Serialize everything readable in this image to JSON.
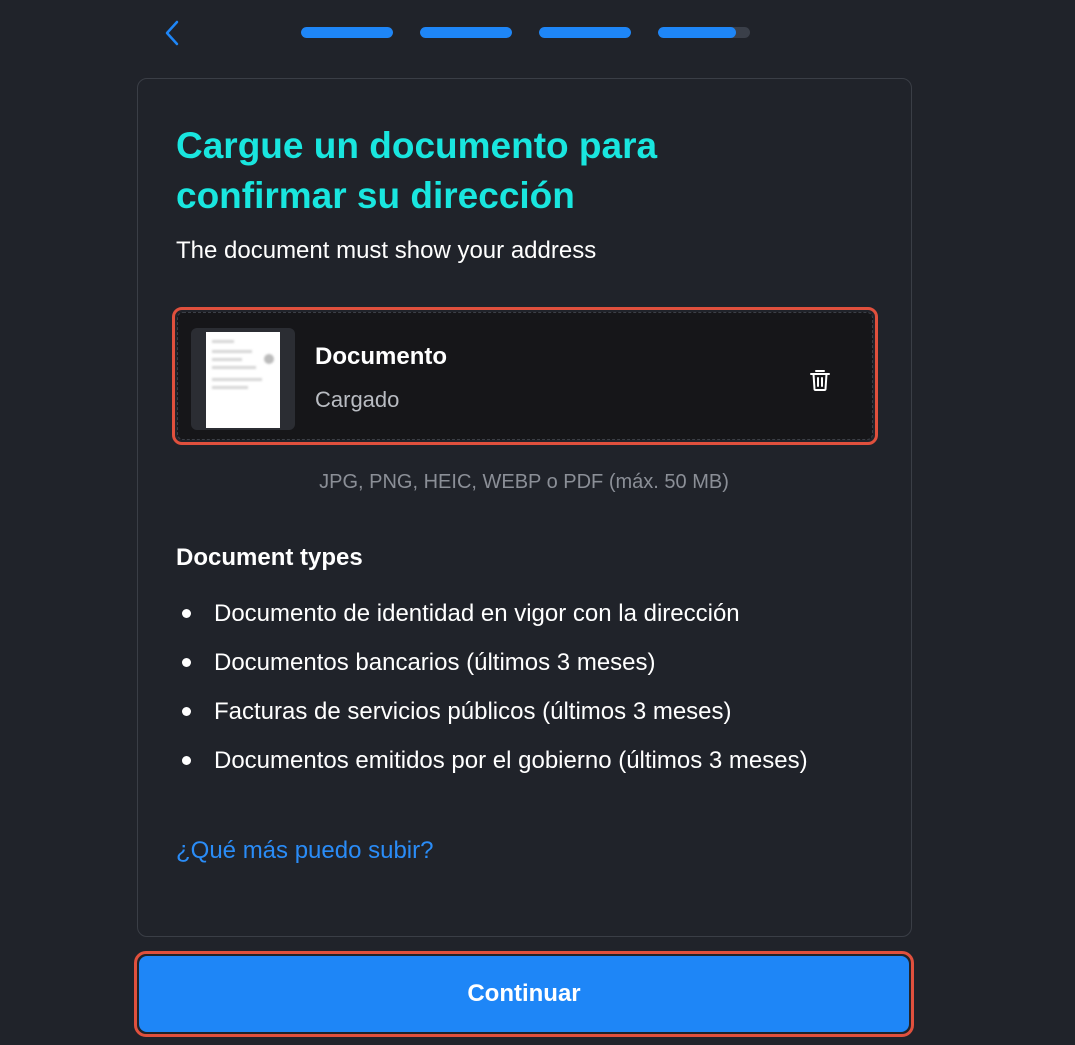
{
  "nav": {
    "back_icon": "chevron-left-icon",
    "progress_steps": [
      {
        "fill": 1.0
      },
      {
        "fill": 1.0
      },
      {
        "fill": 1.0
      },
      {
        "fill": 0.85
      }
    ]
  },
  "card": {
    "title": "Cargue un documento para confirmar su dirección",
    "subtitle": "The document must show your address",
    "upload": {
      "name": "Documento",
      "status": "Cargado",
      "delete_icon": "trash-icon"
    },
    "formats": "JPG, PNG, HEIC, WEBP o PDF (máx. 50 MB)",
    "types_heading": "Document types",
    "types": [
      "Documento de identidad en vigor con la dirección",
      "Documentos bancarios (últimos 3 meses)",
      "Facturas de servicios públicos (últimos 3 meses)",
      "Documentos emitidos por el gobierno (últimos 3 meses)"
    ],
    "more_link": "¿Qué más puedo subir?"
  },
  "continue_label": "Continuar",
  "colors": {
    "accent": "#1e86f7",
    "title": "#19e6df",
    "highlight": "#e0503d",
    "background": "#20232a"
  }
}
